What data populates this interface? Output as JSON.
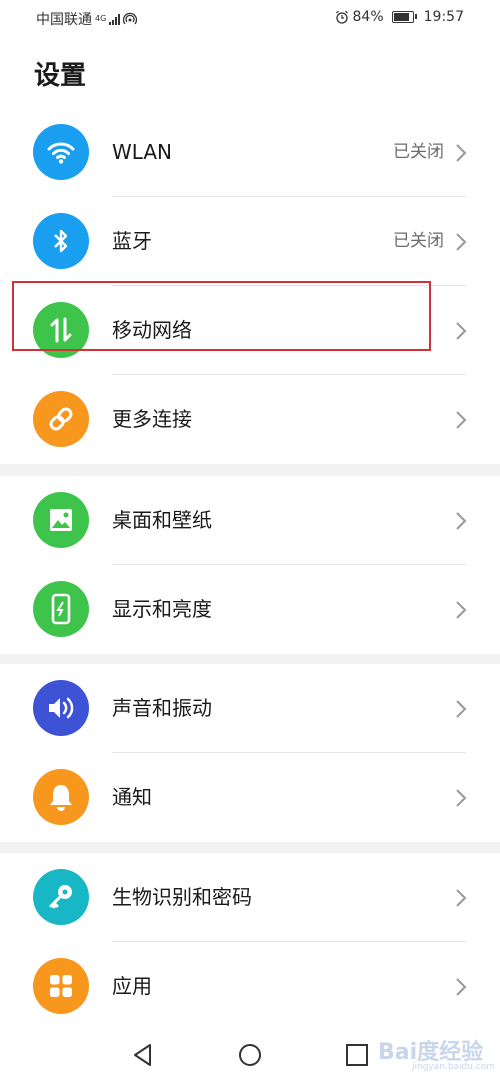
{
  "status_bar": {
    "carrier": "中国联通",
    "network_type": "4G",
    "battery": "84%",
    "time": "19:57"
  },
  "page_title": "设置",
  "groups": [
    {
      "items": [
        {
          "label": "WLAN",
          "value": "已关闭",
          "icon": "wifi-icon",
          "color": "#1a9ef0"
        },
        {
          "label": "蓝牙",
          "value": "已关闭",
          "icon": "bluetooth-icon",
          "color": "#1a9ef0"
        },
        {
          "label": "移动网络",
          "value": "",
          "icon": "mobile-data-icon",
          "color": "#3ec44b"
        },
        {
          "label": "更多连接",
          "value": "",
          "icon": "link-icon",
          "color": "#f7971e"
        }
      ]
    },
    {
      "items": [
        {
          "label": "桌面和壁纸",
          "value": "",
          "icon": "wallpaper-icon",
          "color": "#3ec44b"
        },
        {
          "label": "显示和亮度",
          "value": "",
          "icon": "brightness-icon",
          "color": "#3ec44b"
        }
      ]
    },
    {
      "items": [
        {
          "label": "声音和振动",
          "value": "",
          "icon": "sound-icon",
          "color": "#3d52d5"
        },
        {
          "label": "通知",
          "value": "",
          "icon": "bell-icon",
          "color": "#f7971e"
        }
      ]
    },
    {
      "items": [
        {
          "label": "生物识别和密码",
          "value": "",
          "icon": "key-icon",
          "color": "#18b7c6"
        },
        {
          "label": "应用",
          "value": "",
          "icon": "apps-icon",
          "color": "#f7971e"
        }
      ]
    }
  ],
  "watermark": {
    "brand": "Bai度经验",
    "url": "jingyan.baidu.com"
  }
}
